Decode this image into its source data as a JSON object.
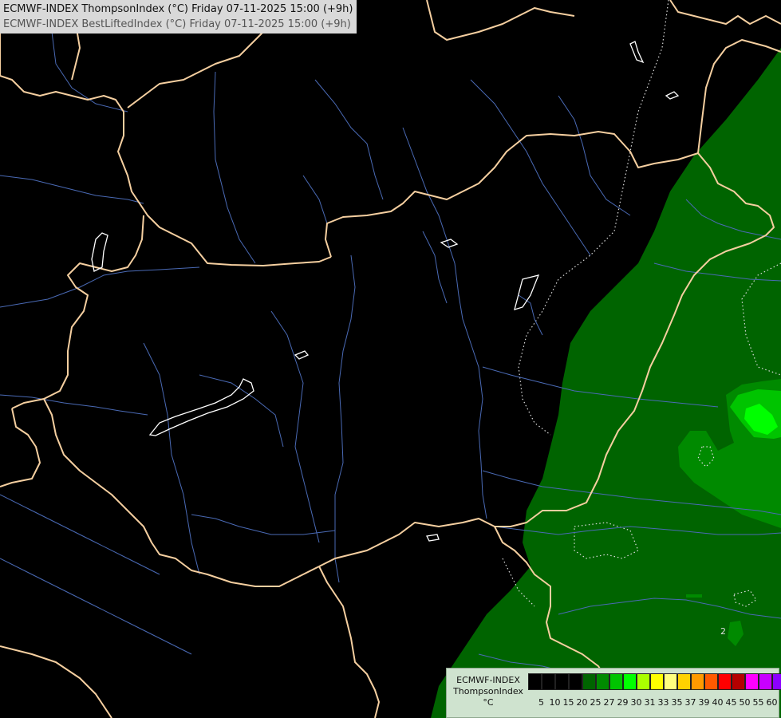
{
  "header": {
    "line1": "ECMWF-INDEX ThompsonIndex (°C) Friday 07-11-2025 15:00 (+9h)",
    "line2": "ECMWF-INDEX BestLiftedIndex (°C) Friday 07-11-2025 15:00 (+9h)"
  },
  "map": {
    "contour_label": "2",
    "fill_colors": {
      "level_20_25": "#006400",
      "level_25_27": "#008a00",
      "level_27_29": "#00c400",
      "level_29_30": "#00ff00"
    },
    "border_color": "#f5cfa0",
    "river_color": "#4a6ab5",
    "lake_outline_color": "#ffffff"
  },
  "legend": {
    "caption_line1": "ECMWF-INDEX",
    "caption_line2": "ThompsonIndex",
    "caption_line3": "°C",
    "colors": [
      "#000000",
      "#000000",
      "#000000",
      "#000000",
      "#006400",
      "#008a00",
      "#00c400",
      "#00ff00",
      "#aaff00",
      "#ffff00",
      "#ffff7f",
      "#ffd200",
      "#ff9a00",
      "#ff5a00",
      "#ff0000",
      "#b40000",
      "#ff00ff",
      "#c800ff",
      "#8c00ff",
      "#5a00ff",
      "#0000ff"
    ],
    "ticks": [
      "5",
      "10",
      "15",
      "20",
      "25",
      "27",
      "29",
      "30",
      "31",
      "33",
      "35",
      "37",
      "39",
      "40",
      "45",
      "50",
      "55",
      "60"
    ]
  }
}
